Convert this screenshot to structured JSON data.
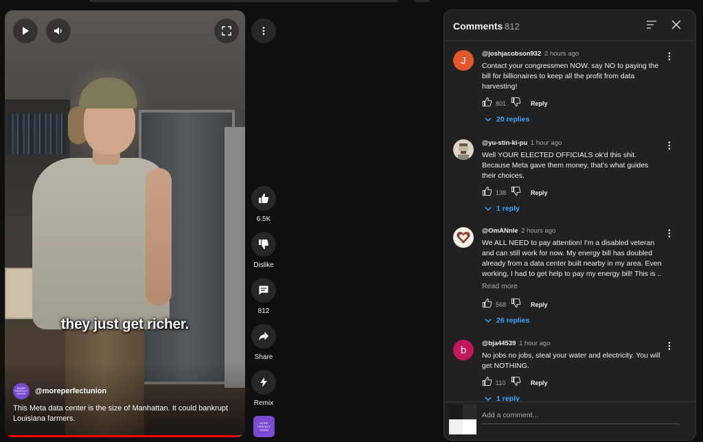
{
  "video": {
    "caption": "they just get richer.",
    "channel_name": "@moreperfectunion",
    "channel_avatar_text": "MORE PERFECT UNION",
    "description": "This Meta data center is the size of Manhattan. It could bankrupt Louisiana farmers.",
    "progress": 0.97
  },
  "actions": {
    "like_count": "6.5K",
    "dislike_label": "Dislike",
    "comment_count": "812",
    "share_label": "Share",
    "remix_label": "Remix",
    "remix_thumb_text": "MORE PERFECT UNION"
  },
  "comments_panel": {
    "title": "Comments",
    "count": "812",
    "add_comment_placeholder": "Add a comment...",
    "comments": [
      {
        "author": "@joshjacobson932",
        "time": "2 hours ago",
        "avatar_letter": "J",
        "avatar_color": "#e4572e",
        "text": "Contact your congressmen NOW. say NO to paying the bill for billionaires to keep all the profit from data harvesting!",
        "likes": "801",
        "reply_label": "Reply",
        "replies": "20 replies"
      },
      {
        "author": "@yu-stin-ki-pu",
        "time": "1 hour ago",
        "avatar_letter": "",
        "avatar_color": "#d9d6c7",
        "text": "Well YOUR ELECTED OFFICIALS ok'd this shit. Because Meta gave them money, that's what guides their choices.",
        "likes": "138",
        "reply_label": "Reply",
        "replies": "1 reply"
      },
      {
        "author": "@OmANnle",
        "time": "2 hours ago",
        "avatar_letter": "",
        "avatar_color": "#f4efe6",
        "text": "We ALL NEED to pay attention! I'm a disabled veteran and can still work for now. My energy bill has doubled already from a data center built nearby in my area. Even working, I had to get help to pay my energy bill! This is ..",
        "read_more": "Read more",
        "likes": "568",
        "reply_label": "Reply",
        "replies": "26 replies"
      },
      {
        "author": "@bja44539",
        "time": "1 hour ago",
        "avatar_letter": "b",
        "avatar_color": "#c2185b",
        "text": "No jobs no jobs, steal your water and electricity. You will get NOTHING.",
        "likes": "110",
        "reply_label": "Reply",
        "replies": "1 reply"
      }
    ]
  },
  "icons": [
    "play-icon",
    "volume-icon",
    "fullscreen-icon",
    "more-vert-icon",
    "thumb-up-icon",
    "thumb-down-icon",
    "comment-icon",
    "share-icon",
    "remix-icon",
    "sort-icon",
    "close-icon",
    "chevron-down-icon"
  ]
}
